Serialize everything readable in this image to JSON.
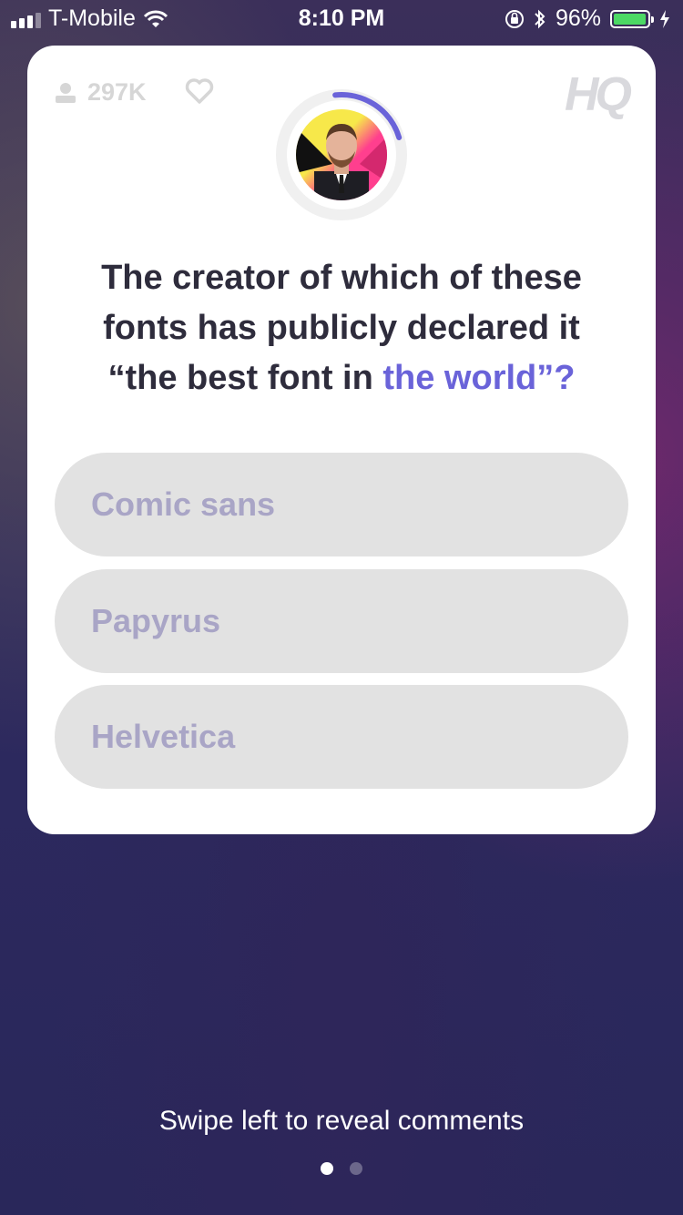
{
  "status_bar": {
    "carrier": "T-Mobile",
    "time": "8:10 PM",
    "battery_percent": "96%",
    "battery_level": 0.96,
    "icons": [
      "signal-icon",
      "wifi-icon",
      "orientation-lock-icon",
      "bluetooth-icon",
      "battery-icon",
      "charging-icon"
    ]
  },
  "game": {
    "viewer_count": "297K",
    "logo_text": "HQ",
    "timer_progress": 0.22,
    "accent_color": "#6a63d9",
    "question_part1": "The creator of which of these fonts has publicly declared it “the best font in ",
    "question_part2": "the world”?",
    "answers": [
      {
        "label": "Comic sans"
      },
      {
        "label": "Papyrus"
      },
      {
        "label": "Helvetica"
      }
    ]
  },
  "footer": {
    "hint": "Swipe left to reveal comments",
    "page_count": 2,
    "active_page": 1
  }
}
